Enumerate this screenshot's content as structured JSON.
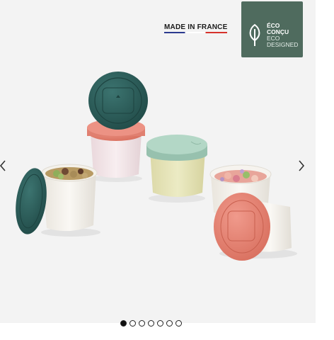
{
  "badge_made_in": "MADE IN FRANCE",
  "eco_badge": {
    "line1": "ÉCO",
    "line2": "CONÇU",
    "line3": "ECO",
    "line4": "DESIGNED"
  },
  "carousel": {
    "slide_count": 7,
    "active_index": 0
  },
  "colors": {
    "eco_badge_bg": "#4f6b5e",
    "lid_dark_teal": "#2a5a57",
    "lid_coral": "#e8877a",
    "lid_mint": "#a9cfbd"
  },
  "icons": {
    "prev": "chevron-left-icon",
    "next": "chevron-right-icon",
    "eco": "leaf-icon"
  }
}
